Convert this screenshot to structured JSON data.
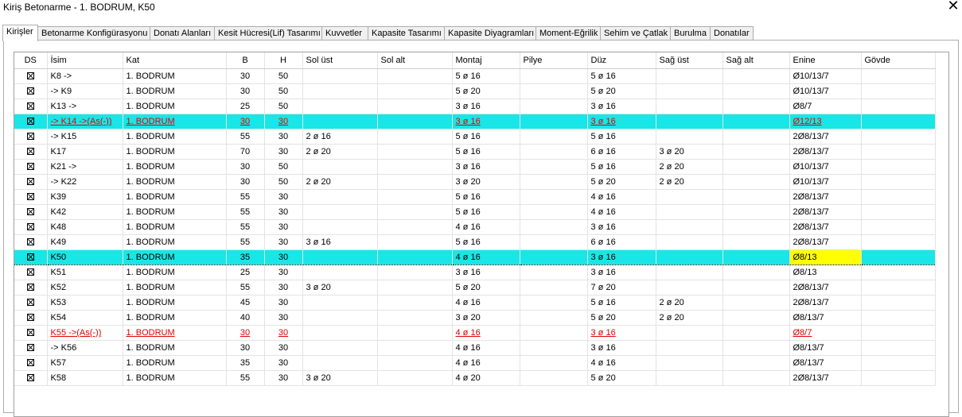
{
  "window": {
    "title": "Kiriş Betonarme - 1. BODRUM, K50",
    "close_glyph": "✕"
  },
  "tabs": [
    "Kirişler",
    "Betonarme Konfigürasyonu",
    "Donatı Alanları",
    "Kesit Hücresi(Lif) Tasarımı",
    "Kuvvetler",
    "Kapasite Tasarımı",
    "Kapasite Diyagramları",
    "Moment-Eğrilik",
    "Sehim ve Çatlak",
    "Burulma",
    "Donatılar"
  ],
  "active_tab": "Kirişler",
  "colors": {
    "highlight": "#19e6e6",
    "error": "#e00000",
    "focus_cell": "#ffff00"
  },
  "table": {
    "headers": [
      "DS",
      "İsim",
      "Kat",
      "B",
      "H",
      "Sol üst",
      "Sol alt",
      "Montaj",
      "Pilye",
      "Düz",
      "Sağ üst",
      "Sağ alt",
      "Enine",
      "Gövde"
    ],
    "rows": [
      {
        "ds": "checked",
        "isim": "K8 ->",
        "kat": "1. BODRUM",
        "b": "30",
        "h": "50",
        "sol_ust": "",
        "sol_alt": "",
        "montaj": "5 ø 16",
        "pilye": "",
        "duz": "5 ø 16",
        "sag_ust": "",
        "sag_alt": "",
        "enine": "Ø10/13/7",
        "govde": "",
        "state": ""
      },
      {
        "ds": "checked",
        "isim": "-> K9",
        "kat": "1. BODRUM",
        "b": "30",
        "h": "50",
        "sol_ust": "",
        "sol_alt": "",
        "montaj": "5 ø 20",
        "pilye": "",
        "duz": "5 ø 20",
        "sag_ust": "",
        "sag_alt": "",
        "enine": "Ø10/13/7",
        "govde": "",
        "state": ""
      },
      {
        "ds": "checked",
        "isim": "K13 ->",
        "kat": "1. BODRUM",
        "b": "25",
        "h": "50",
        "sol_ust": "",
        "sol_alt": "",
        "montaj": "3 ø 16",
        "pilye": "",
        "duz": "3 ø 16",
        "sag_ust": "",
        "sag_alt": "",
        "enine": "Ø8/7",
        "govde": "",
        "state": ""
      },
      {
        "ds": "checked",
        "isim": "-> K14 ->(As(-))",
        "kat": "1. BODRUM",
        "b": "30",
        "h": "30",
        "sol_ust": "",
        "sol_alt": "",
        "montaj": "3 ø 16",
        "pilye": "",
        "duz": "3 ø 16",
        "sag_ust": "",
        "sag_alt": "",
        "enine": "Ø12/13",
        "govde": "",
        "state": "hl-err"
      },
      {
        "ds": "checked",
        "isim": "-> K15",
        "kat": "1. BODRUM",
        "b": "55",
        "h": "30",
        "sol_ust": "2 ø 16",
        "sol_alt": "",
        "montaj": "5 ø 16",
        "pilye": "",
        "duz": "5 ø 16",
        "sag_ust": "",
        "sag_alt": "",
        "enine": "2Ø8/13/7",
        "govde": "",
        "state": ""
      },
      {
        "ds": "checked",
        "isim": "K17",
        "kat": "1. BODRUM",
        "b": "70",
        "h": "30",
        "sol_ust": "2 ø 20",
        "sol_alt": "",
        "montaj": "5 ø 16",
        "pilye": "",
        "duz": "6 ø 16",
        "sag_ust": "3 ø 20",
        "sag_alt": "",
        "enine": "2Ø8/13/7",
        "govde": "",
        "state": ""
      },
      {
        "ds": "checked",
        "isim": "K21 ->",
        "kat": "1. BODRUM",
        "b": "30",
        "h": "50",
        "sol_ust": "",
        "sol_alt": "",
        "montaj": "3 ø 16",
        "pilye": "",
        "duz": "5 ø 16",
        "sag_ust": "2 ø 20",
        "sag_alt": "",
        "enine": "Ø10/13/7",
        "govde": "",
        "state": ""
      },
      {
        "ds": "checked",
        "isim": "-> K22",
        "kat": "1. BODRUM",
        "b": "30",
        "h": "50",
        "sol_ust": "2 ø 20",
        "sol_alt": "",
        "montaj": "3 ø 20",
        "pilye": "",
        "duz": "5 ø 20",
        "sag_ust": "2 ø 20",
        "sag_alt": "",
        "enine": "Ø10/13/7",
        "govde": "",
        "state": ""
      },
      {
        "ds": "checked",
        "isim": "K39",
        "kat": "1. BODRUM",
        "b": "55",
        "h": "30",
        "sol_ust": "",
        "sol_alt": "",
        "montaj": "5 ø 16",
        "pilye": "",
        "duz": "4 ø 16",
        "sag_ust": "",
        "sag_alt": "",
        "enine": "2Ø8/13/7",
        "govde": "",
        "state": ""
      },
      {
        "ds": "checked",
        "isim": "K42",
        "kat": "1. BODRUM",
        "b": "55",
        "h": "30",
        "sol_ust": "",
        "sol_alt": "",
        "montaj": "5 ø 16",
        "pilye": "",
        "duz": "4 ø 16",
        "sag_ust": "",
        "sag_alt": "",
        "enine": "2Ø8/13/7",
        "govde": "",
        "state": ""
      },
      {
        "ds": "checked",
        "isim": "K48",
        "kat": "1. BODRUM",
        "b": "55",
        "h": "30",
        "sol_ust": "",
        "sol_alt": "",
        "montaj": "4 ø 16",
        "pilye": "",
        "duz": "3 ø 16",
        "sag_ust": "",
        "sag_alt": "",
        "enine": "2Ø8/13/7",
        "govde": "",
        "state": ""
      },
      {
        "ds": "checked",
        "isim": "K49",
        "kat": "1. BODRUM",
        "b": "55",
        "h": "30",
        "sol_ust": "3 ø 16",
        "sol_alt": "",
        "montaj": "5 ø 16",
        "pilye": "",
        "duz": "6 ø 16",
        "sag_ust": "",
        "sag_alt": "",
        "enine": "2Ø8/13/7",
        "govde": "",
        "state": ""
      },
      {
        "ds": "checked",
        "isim": "K50",
        "kat": "1. BODRUM",
        "b": "35",
        "h": "30",
        "sol_ust": "",
        "sol_alt": "",
        "montaj": "4 ø 16",
        "pilye": "",
        "duz": "3 ø 16",
        "sag_ust": "",
        "sag_alt": "",
        "enine": "Ø8/13",
        "govde": "",
        "state": "hl-focus"
      },
      {
        "ds": "checked",
        "isim": "K51",
        "kat": "1. BODRUM",
        "b": "25",
        "h": "30",
        "sol_ust": "",
        "sol_alt": "",
        "montaj": "3 ø 16",
        "pilye": "",
        "duz": "3 ø 16",
        "sag_ust": "",
        "sag_alt": "",
        "enine": "Ø8/13",
        "govde": "",
        "state": ""
      },
      {
        "ds": "checked",
        "isim": "K52",
        "kat": "1. BODRUM",
        "b": "55",
        "h": "30",
        "sol_ust": "3 ø 20",
        "sol_alt": "",
        "montaj": "5 ø 20",
        "pilye": "",
        "duz": "7 ø 20",
        "sag_ust": "",
        "sag_alt": "",
        "enine": "2Ø8/13/7",
        "govde": "",
        "state": ""
      },
      {
        "ds": "checked",
        "isim": "K53",
        "kat": "1. BODRUM",
        "b": "45",
        "h": "30",
        "sol_ust": "",
        "sol_alt": "",
        "montaj": "4 ø 16",
        "pilye": "",
        "duz": "5 ø 16",
        "sag_ust": "2 ø 20",
        "sag_alt": "",
        "enine": "2Ø8/13/7",
        "govde": "",
        "state": ""
      },
      {
        "ds": "checked",
        "isim": "K54",
        "kat": "1. BODRUM",
        "b": "40",
        "h": "30",
        "sol_ust": "",
        "sol_alt": "",
        "montaj": "3 ø 20",
        "pilye": "",
        "duz": "5 ø 20",
        "sag_ust": "2 ø 20",
        "sag_alt": "",
        "enine": "Ø8/13/7",
        "govde": "",
        "state": ""
      },
      {
        "ds": "checked",
        "isim": "K55 ->(As(-))",
        "kat": "1. BODRUM",
        "b": "30",
        "h": "30",
        "sol_ust": "",
        "sol_alt": "",
        "montaj": "4 ø 16",
        "pilye": "",
        "duz": "3 ø 16",
        "sag_ust": "",
        "sag_alt": "",
        "enine": "Ø8/7",
        "govde": "",
        "state": "err"
      },
      {
        "ds": "checked",
        "isim": "-> K56",
        "kat": "1. BODRUM",
        "b": "30",
        "h": "30",
        "sol_ust": "",
        "sol_alt": "",
        "montaj": "4 ø 16",
        "pilye": "",
        "duz": "3 ø 16",
        "sag_ust": "",
        "sag_alt": "",
        "enine": "Ø8/13/7",
        "govde": "",
        "state": ""
      },
      {
        "ds": "checked",
        "isim": "K57",
        "kat": "1. BODRUM",
        "b": "35",
        "h": "30",
        "sol_ust": "",
        "sol_alt": "",
        "montaj": "4 ø 16",
        "pilye": "",
        "duz": "4 ø 16",
        "sag_ust": "",
        "sag_alt": "",
        "enine": "Ø8/13/7",
        "govde": "",
        "state": ""
      },
      {
        "ds": "checked",
        "isim": "K58",
        "kat": "1. BODRUM",
        "b": "55",
        "h": "30",
        "sol_ust": "3 ø 20",
        "sol_alt": "",
        "montaj": "4 ø 20",
        "pilye": "",
        "duz": "5 ø 20",
        "sag_ust": "",
        "sag_alt": "",
        "enine": "2Ø8/13/7",
        "govde": "",
        "state": ""
      }
    ]
  }
}
